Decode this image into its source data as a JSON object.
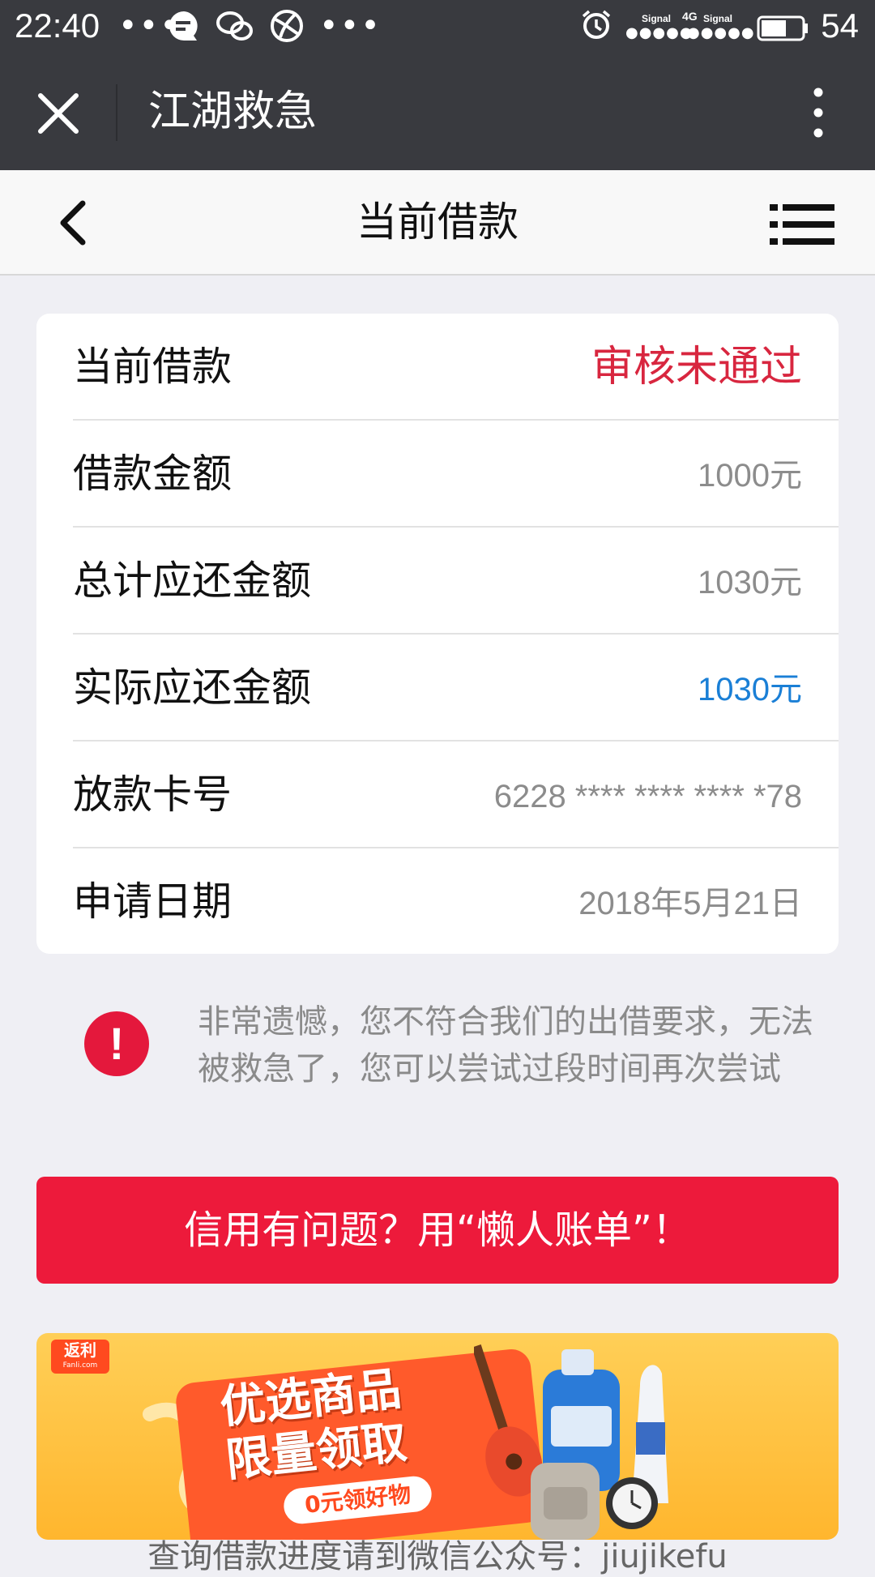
{
  "status_bar": {
    "time": "22:40",
    "signal_label_1": "Signal",
    "signal_label_2": "Signal",
    "network_type": "4G",
    "battery_level": "54"
  },
  "app_bar": {
    "title": "江湖救急"
  },
  "page_header": {
    "title": "当前借款"
  },
  "loan_info": {
    "rows": [
      {
        "label": "当前借款",
        "value": "审核未通过"
      },
      {
        "label": "借款金额",
        "value": "1000元"
      },
      {
        "label": "总计应还金额",
        "value": "1030元"
      },
      {
        "label": "实际应还金额",
        "value": "1030元"
      },
      {
        "label": "放款卡号",
        "value": "6228 **** **** **** *78"
      },
      {
        "label": "申请日期",
        "value": "2018年5月21日"
      }
    ]
  },
  "notice": {
    "icon": "!",
    "text": "非常遗憾，您不符合我们的出借要求，无法被救急了，您可以尝试过段时间再次尝试"
  },
  "cta": {
    "label": "信用有问题？用“懒人账单”！"
  },
  "banner": {
    "logo": "返利",
    "logo_sub": "Fanli.com",
    "title_line1": "优选商品",
    "title_line2": "限量领取",
    "subtitle": "0元领好物"
  },
  "footer": {
    "tip": "查询借款进度请到微信公众号：jiujikefu"
  },
  "colors": {
    "status_red": "#d8263f",
    "value_blue": "#1a7fd6",
    "cta_red": "#ed1a3b",
    "bar_dark": "#393a3f"
  }
}
